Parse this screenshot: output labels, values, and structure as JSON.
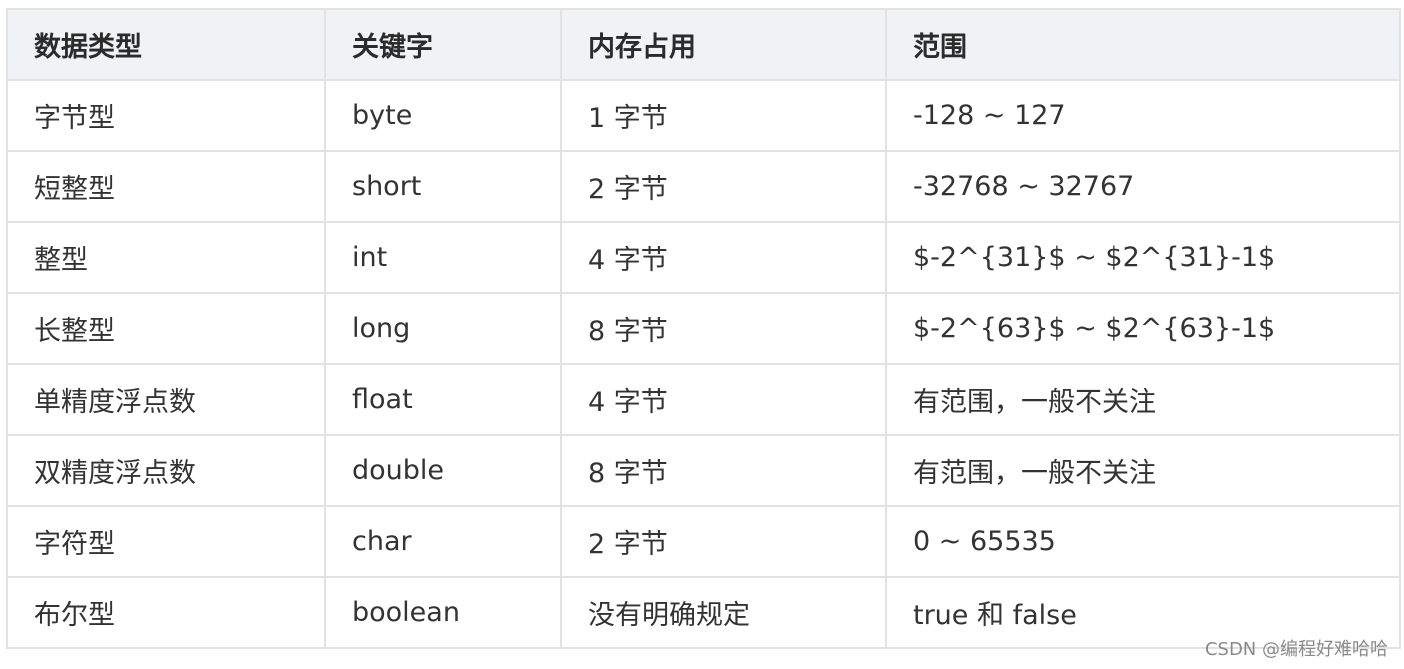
{
  "table": {
    "headers": [
      "数据类型",
      "关键字",
      "内存占用",
      "范围"
    ],
    "rows": [
      [
        "字节型",
        "byte",
        "1 字节",
        "-128 ~ 127"
      ],
      [
        "短整型",
        "short",
        "2 字节",
        "-32768 ~ 32767"
      ],
      [
        "整型",
        "int",
        "4 字节",
        "$-2^{31}$ ~ $2^{31}-1$"
      ],
      [
        "长整型",
        "long",
        "8 字节",
        "$-2^{63}$ ~ $2^{63}-1$"
      ],
      [
        "单精度浮点数",
        "float",
        "4 字节",
        "有范围，一般不关注"
      ],
      [
        "双精度浮点数",
        "double",
        "8 字节",
        "有范围，一般不关注"
      ],
      [
        "字符型",
        "char",
        "2 字节",
        "0 ~ 65535"
      ],
      [
        "布尔型",
        "boolean",
        "没有明确规定",
        "true 和 false"
      ]
    ]
  },
  "watermark": "CSDN @编程好难哈哈"
}
